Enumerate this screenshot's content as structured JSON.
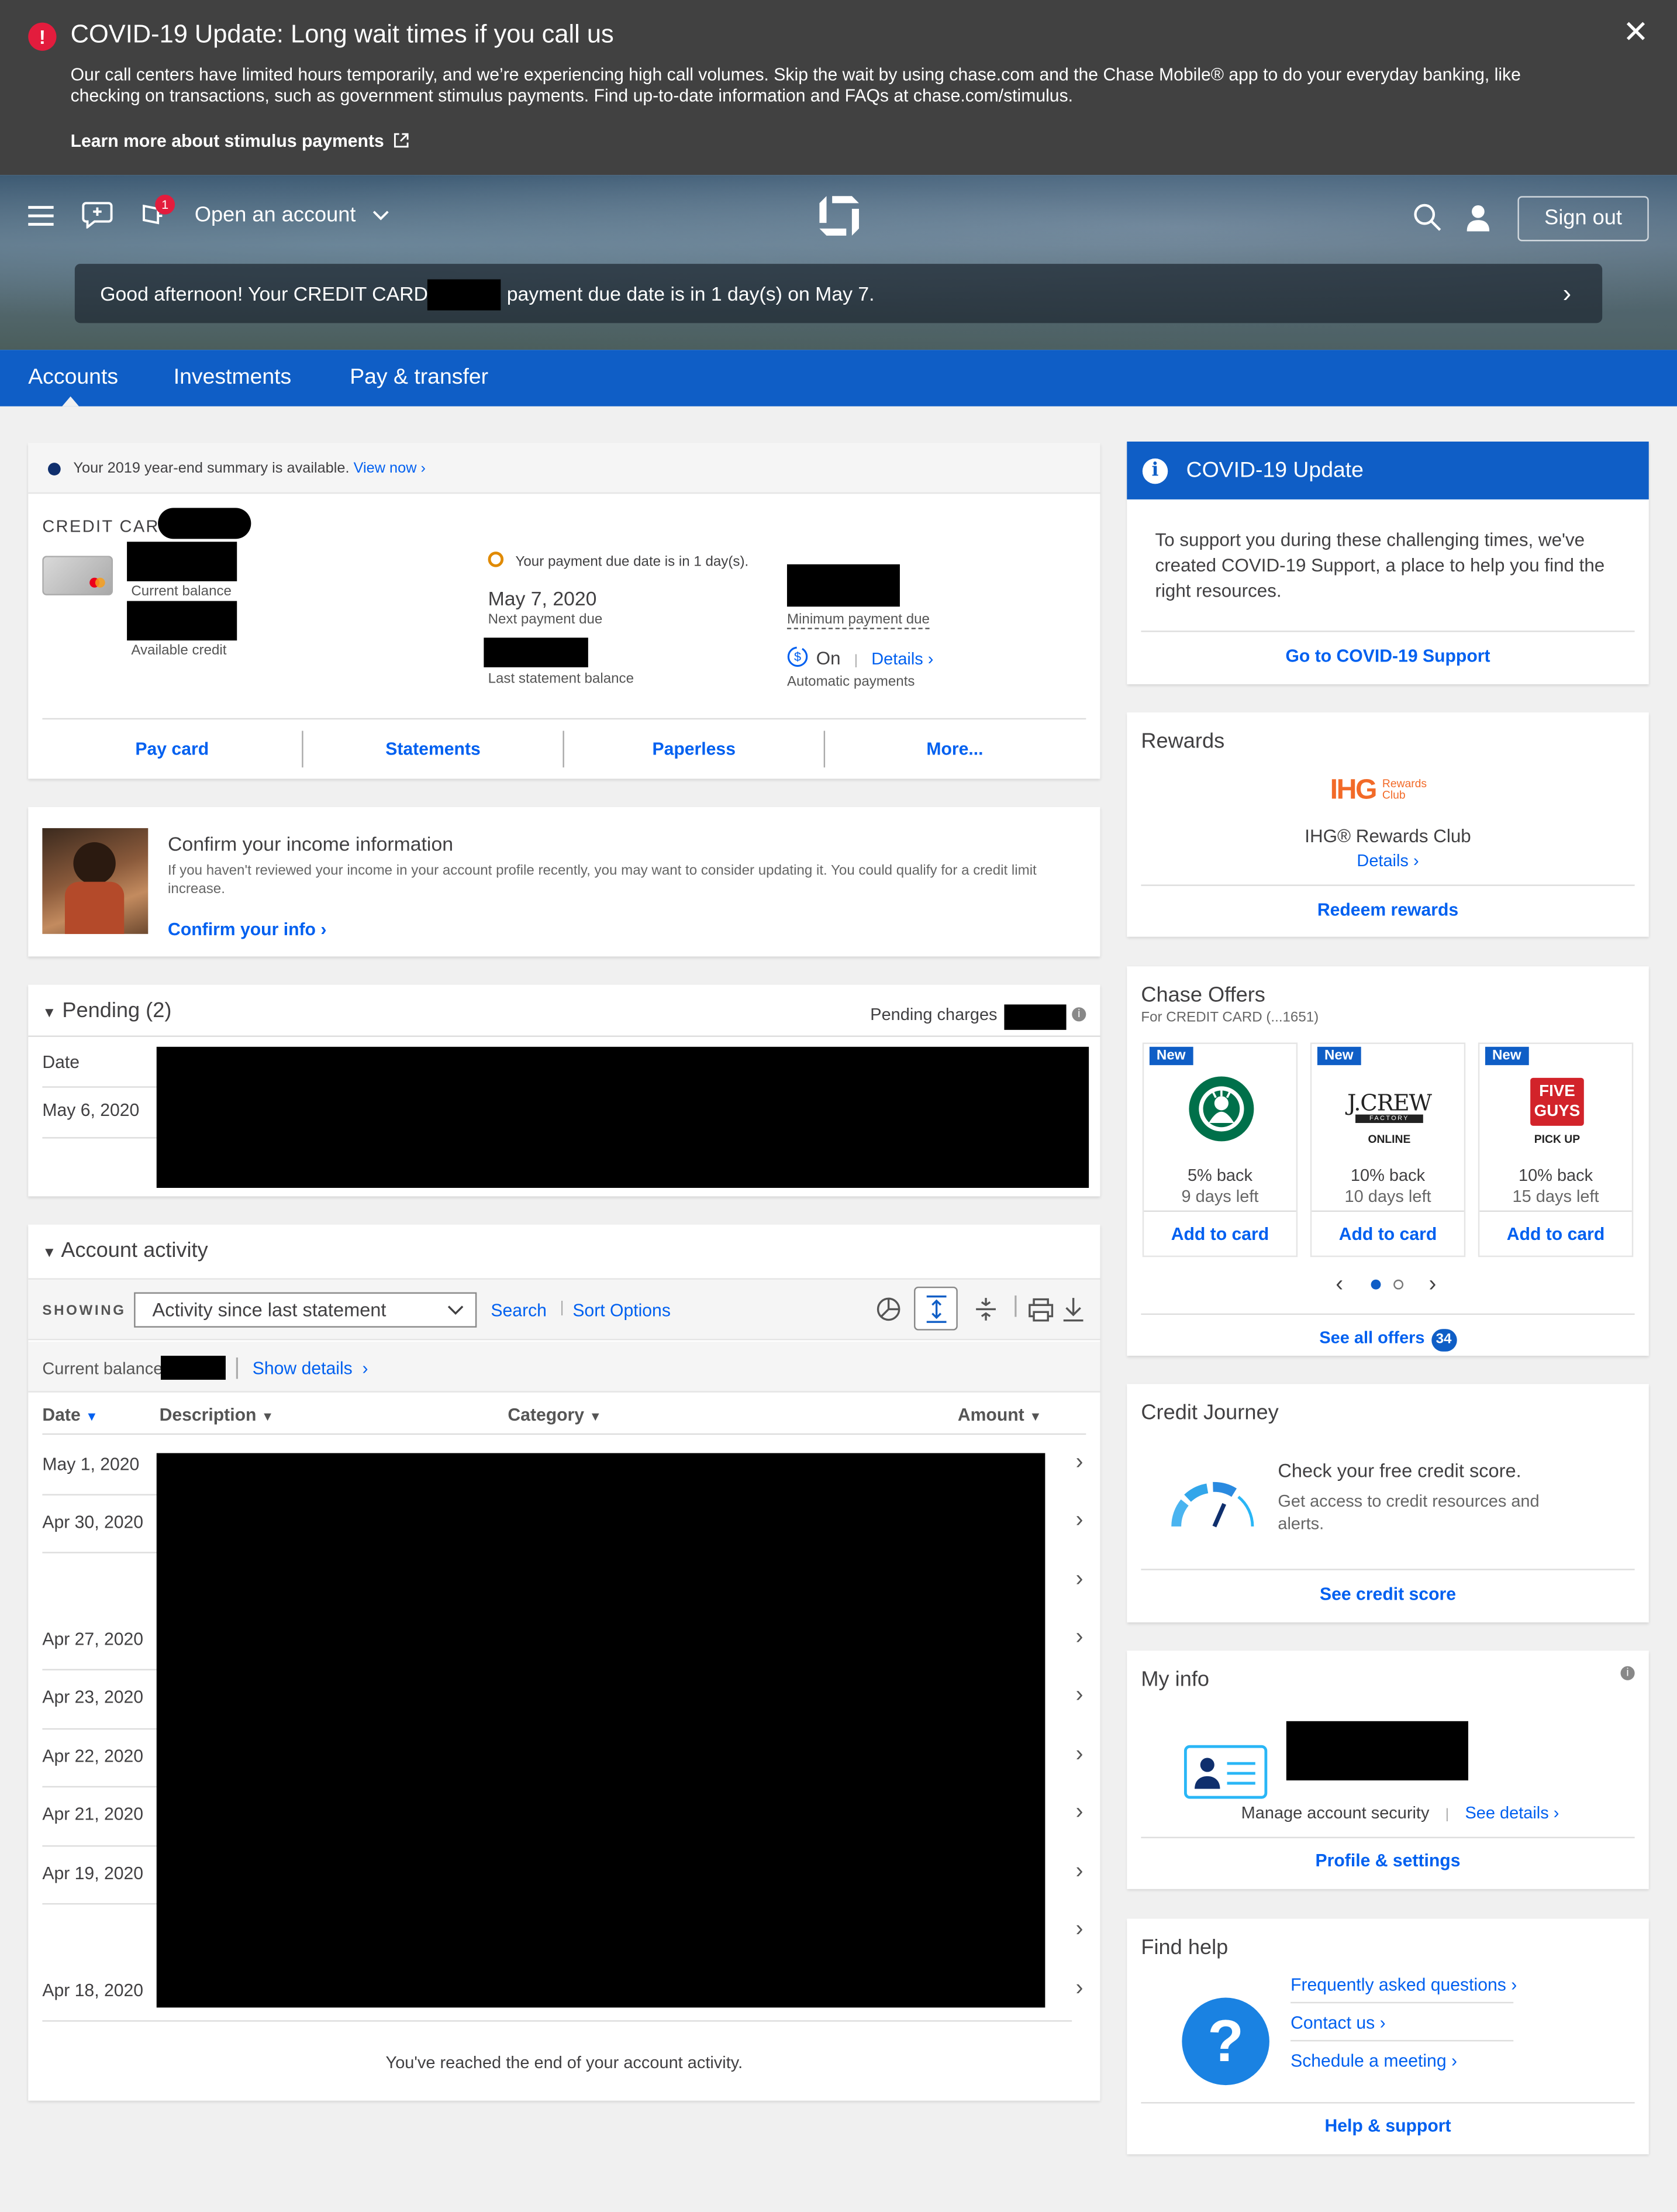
{
  "banner": {
    "title": "COVID-19 Update: Long wait times if you call us",
    "body": "Our call centers have limited hours temporarily, and we’re experiencing high call volumes. Skip the wait by using chase.com and the Chase Mobile® app to do your everyday banking, like checking on transactions, such as government stimulus payments. Find up-to-date information and FAQs at chase.com/stimulus.",
    "link": "Learn more about stimulus payments",
    "close_icon": "close-icon"
  },
  "header": {
    "notification_count": "1",
    "open_account": "Open an account",
    "sign_out": "Sign out",
    "greeting_prefix": "Good afternoon! Your CREDIT CARD",
    "greeting_suffix": "payment due date is in 1 day(s) on May 7."
  },
  "nav": {
    "tabs": [
      "Accounts",
      "Investments",
      "Pay & transfer"
    ]
  },
  "summary": {
    "year_end_text": "Your 2019 year-end summary is available.",
    "year_end_link": "View now",
    "card_title": "CREDIT CARD",
    "current_balance_label": "Current balance",
    "available_credit_label": "Available credit",
    "due_notice": "Your payment due date is in 1 day(s).",
    "next_due_date": "May 7, 2020",
    "next_due_label": "Next payment due",
    "last_statement_label": "Last statement balance",
    "minimum_due_label": "Minimum payment due",
    "autopay_state": "On",
    "autopay_details": "Details",
    "autopay_label": "Automatic payments",
    "actions": [
      "Pay card",
      "Statements",
      "Paperless",
      "More..."
    ]
  },
  "income": {
    "title": "Confirm your income information",
    "body": "If you haven't reviewed your income in your account profile recently, you may want to consider updating it. You could qualify for a credit limit increase.",
    "link": "Confirm your info"
  },
  "pending": {
    "title": "Pending (2)",
    "charges_label": "Pending charges",
    "date_header": "Date",
    "rows": [
      "May 6, 2020",
      ""
    ]
  },
  "activity": {
    "title": "Account activity",
    "showing_label": "SHOWING",
    "filter_value": "Activity since last statement",
    "search": "Search",
    "sort": "Sort Options",
    "current_balance_label": "Current balance",
    "show_details": "Show details",
    "columns": [
      "Date",
      "Description",
      "Category",
      "Amount"
    ],
    "rows": [
      "May 1, 2020",
      "Apr 30, 2020",
      "",
      "Apr 27, 2020",
      "Apr 23, 2020",
      "Apr 22, 2020",
      "Apr 21, 2020",
      "Apr 19, 2020",
      "",
      "Apr 18, 2020"
    ],
    "end_text": "You've reached the end of your account activity."
  },
  "covid_card": {
    "title": "COVID-19 Update",
    "body": "To support you during these challenging times, we've created COVID-19 Support, a place to help you find the right resources.",
    "link": "Go to COVID-19 Support"
  },
  "rewards": {
    "title": "Rewards",
    "logo_text": "IHG",
    "logo_small": "Rewards Club",
    "program": "IHG® Rewards Club",
    "details": "Details",
    "redeem": "Redeem rewards"
  },
  "offers": {
    "title": "Chase Offers",
    "subtitle": "For CREDIT CARD (...1651)",
    "items": [
      {
        "badge": "New",
        "brand": "Starbucks",
        "pct": "5% back",
        "days": "9 days left",
        "action": "Add to card"
      },
      {
        "badge": "New",
        "brand": "J.CREW",
        "brand_sub1": "FACTORY",
        "brand_sub2": "ONLINE",
        "pct": "10% back",
        "days": "10 days left",
        "action": "Add to card"
      },
      {
        "badge": "New",
        "brand": "FIVE GUYS",
        "brand_sub1": "PICK UP",
        "pct": "10% back",
        "days": "15 days left",
        "action": "Add to card"
      }
    ],
    "see_all": "See all offers",
    "count": "34"
  },
  "credit_journey": {
    "title": "Credit Journey",
    "headline": "Check your free credit score.",
    "body": "Get access to credit resources and alerts.",
    "link": "See credit score"
  },
  "my_info": {
    "title": "My info",
    "manage": "Manage account security",
    "details": "See details",
    "link": "Profile & settings"
  },
  "find_help": {
    "title": "Find help",
    "links": [
      "Frequently asked questions",
      "Contact us",
      "Schedule a meeting"
    ],
    "footer": "Help & support"
  },
  "colors": {
    "brand_blue": "#0f5ec6",
    "link": "#0060f0",
    "alert_red": "#e31c3d"
  }
}
